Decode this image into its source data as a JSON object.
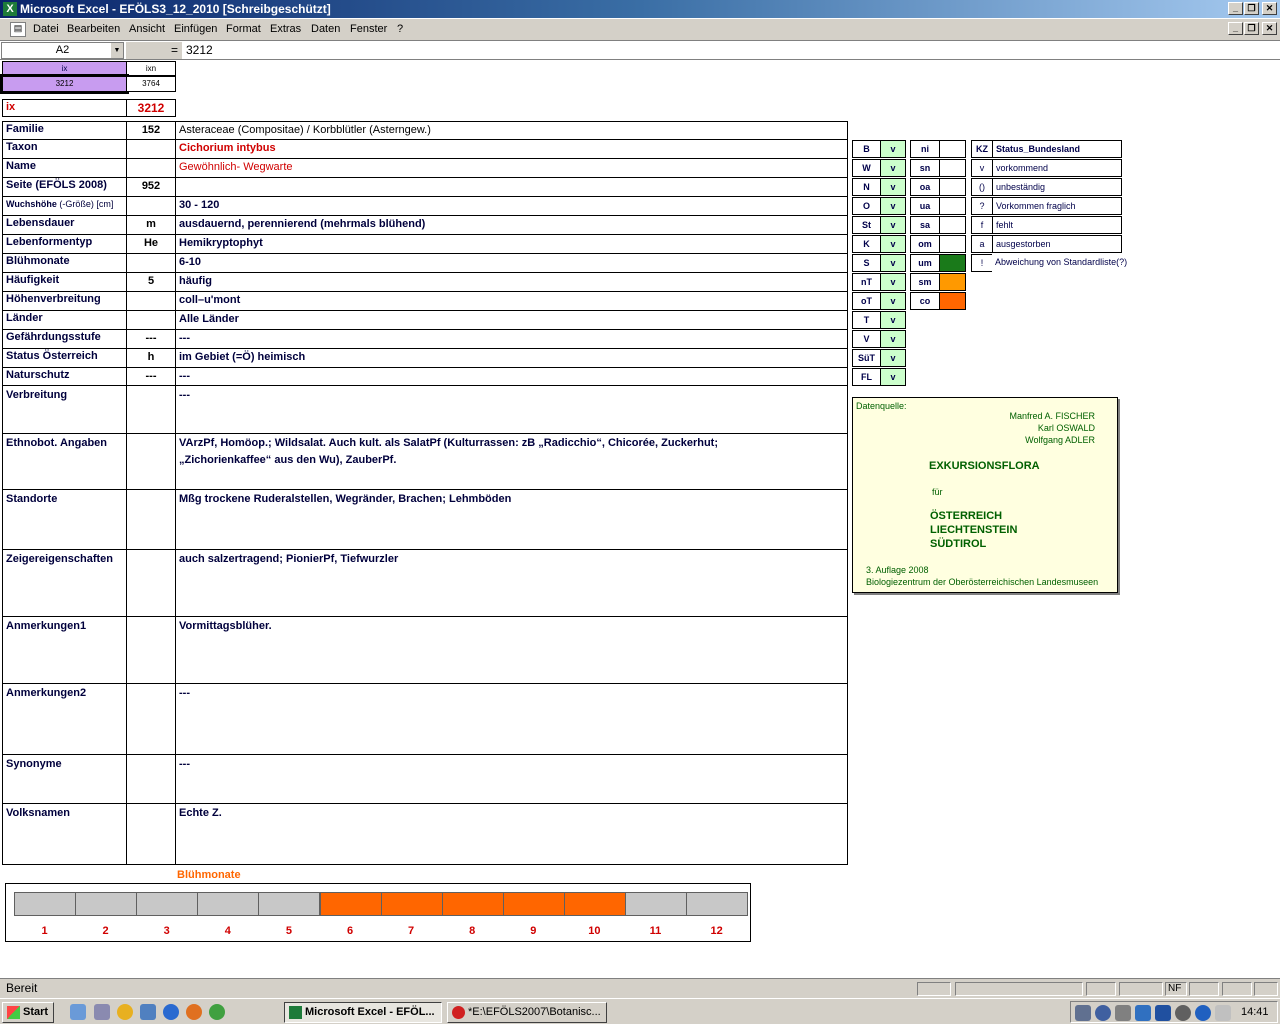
{
  "window": {
    "title": "Microsoft Excel - EFÖLS3_12_2010  [Schreibgeschützt]",
    "icon": "excel-icon"
  },
  "menu": [
    "Datei",
    "Bearbeiten",
    "Ansicht",
    "Einfügen",
    "Format",
    "Extras",
    "Daten",
    "Fenster",
    "?"
  ],
  "formula_bar": {
    "name_box": "A2",
    "equals": "=",
    "value": "3212"
  },
  "top_table": {
    "h1": "ix",
    "h2": "ixn",
    "v1": "3212",
    "v2": "3764"
  },
  "ix_row": {
    "label": "ix",
    "value": "3212"
  },
  "rows": [
    {
      "label": "Familie",
      "code": "152",
      "text": "Asteraceae (Compositae)  /  Korbblütler (Asterngew.)"
    },
    {
      "label": "Taxon",
      "code": "",
      "text": "Cichorium intybus"
    },
    {
      "label": "Name",
      "code": "",
      "text": "Gewöhnlich- Wegwarte"
    },
    {
      "label": "Seite (EFÖLS 2008)",
      "code": "952",
      "text": ""
    },
    {
      "label": "Wuchshöhe",
      "sublabel": "(-Größe) [cm]",
      "code": "",
      "text": "30 - 120"
    },
    {
      "label": "Lebensdauer",
      "code": "m",
      "text": "ausdauernd, perennierend (mehrmals blühend)"
    },
    {
      "label": "Lebenformentyp",
      "code": "He",
      "text": "Hemikryptophyt"
    },
    {
      "label": "Blühmonate",
      "code": "",
      "text": "6-10"
    },
    {
      "label": "Häufigkeit",
      "code": "5",
      "text": "häufig"
    },
    {
      "label": "Höhenverbreitung",
      "code": "",
      "text": "coll–u'mont"
    },
    {
      "label": "Länder",
      "code": "",
      "text": "Alle Länder"
    },
    {
      "label": "Gefährdungsstufe",
      "code": "---",
      "text": "---"
    },
    {
      "label": "Status Österreich",
      "code": "h",
      "text": "im Gebiet (=Ö) heimisch"
    },
    {
      "label": "Naturschutz",
      "code": "---",
      "text": "---"
    }
  ],
  "big_rows": [
    {
      "label": "Verbreitung",
      "text": "---"
    },
    {
      "label": "Ethnobot. Angaben",
      "text": "VArzPf, Homöop.; Wildsalat. Auch kult. als SalatPf (Kulturrassen: zB „Radicchio“, Chicorée, Zuckerhut; „Zichorienkaffee“ aus den Wu), ZauberPf."
    },
    {
      "label": "Standorte",
      "text": "Mßg trockene Ruderalstellen, Wegränder, Brachen; Lehmböden"
    },
    {
      "label": "Zeigereigenschaften",
      "text": "auch salzertragend; PionierPf, Tiefwurzler"
    },
    {
      "label": "Anmerkungen1",
      "text": "Vormittagsblüher."
    },
    {
      "label": "Anmerkungen2",
      "text": "---"
    },
    {
      "label": "Synonyme",
      "text": "---"
    },
    {
      "label": "Volksnamen",
      "text": "Echte Z."
    }
  ],
  "states": [
    {
      "code": "B",
      "v": "v"
    },
    {
      "code": "W",
      "v": "v"
    },
    {
      "code": "N",
      "v": "v"
    },
    {
      "code": "O",
      "v": "v"
    },
    {
      "code": "St",
      "v": "v"
    },
    {
      "code": "K",
      "v": "v"
    },
    {
      "code": "S",
      "v": "v"
    },
    {
      "code": "nT",
      "v": "v"
    },
    {
      "code": "oT",
      "v": "v"
    },
    {
      "code": "T",
      "v": "v"
    },
    {
      "code": "V",
      "v": "v"
    },
    {
      "code": "SüT",
      "v": "v"
    },
    {
      "code": "FL",
      "v": "v"
    }
  ],
  "altitude": [
    {
      "code": "ni",
      "color": "#ffffff"
    },
    {
      "code": "sn",
      "color": "#ffffff"
    },
    {
      "code": "oa",
      "color": "#ffffff"
    },
    {
      "code": "ua",
      "color": "#ffffff"
    },
    {
      "code": "sa",
      "color": "#ffffff"
    },
    {
      "code": "om",
      "color": "#ffffff"
    },
    {
      "code": "um",
      "color": "#1a7a1a"
    },
    {
      "code": "sm",
      "color": "#ff9900"
    },
    {
      "code": "co",
      "color": "#ff6600"
    }
  ],
  "legend": {
    "header_kz": "KZ",
    "header_status": "Status_Bundesland",
    "items": [
      {
        "kz": "v",
        "text": "vorkommend"
      },
      {
        "kz": "()",
        "text": "unbeständig"
      },
      {
        "kz": "?",
        "text": "Vorkommen fraglich"
      },
      {
        "kz": "f",
        "text": "fehlt"
      },
      {
        "kz": "a",
        "text": "ausgestorben"
      },
      {
        "kz": "!",
        "text": "Abweichung von Standardliste(?)"
      }
    ]
  },
  "source": {
    "label": "Datenquelle:",
    "authors": [
      "Manfred A. FISCHER",
      "Karl OSWALD",
      "Wolfgang ADLER"
    ],
    "book": "EXKURSIONSFLORA",
    "fuer": "für",
    "countries": [
      "ÖSTERREICH",
      "LIECHTENSTEIN",
      "SÜDTIROL"
    ],
    "edition": "3. Auflage 2008",
    "publisher": "Biologiezentrum der Oberösterreichischen Landesmuseen"
  },
  "bloom": {
    "title": "Blühmonate",
    "months": [
      "1",
      "2",
      "3",
      "4",
      "5",
      "6",
      "7",
      "8",
      "9",
      "10",
      "11",
      "12"
    ],
    "active": [
      6,
      7,
      8,
      9,
      10
    ],
    "active_color": "#ff6600",
    "inactive_color": "#c8c8c8"
  },
  "status_bar": {
    "text": "Bereit",
    "nf": "NF"
  },
  "taskbar": {
    "start": "Start",
    "tasks": [
      "Microsoft Excel - EFÖL...",
      "*E:\\EFÖLS2007\\Botanisc..."
    ],
    "clock": "14:41"
  }
}
